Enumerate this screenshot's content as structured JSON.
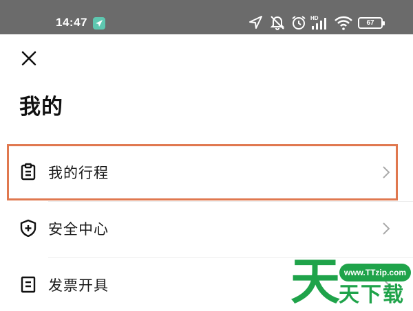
{
  "status_bar": {
    "time": "14:47",
    "battery": "67",
    "hd_label": "HD",
    "background": "#6b6b6b"
  },
  "header": {
    "close_icon": "close-icon",
    "title": "我的"
  },
  "menu": {
    "items": [
      {
        "label": "我的行程",
        "icon": "clipboard-icon",
        "highlighted": true
      },
      {
        "label": "安全中心",
        "icon": "shield-plus-icon"
      },
      {
        "label": "发票开具",
        "icon": "receipt-icon"
      }
    ]
  },
  "highlight_color": "#e0784f",
  "watermark": {
    "url": "www.TTzip.com",
    "big_char": "天",
    "sub_text": "天下载",
    "color": "#1fa34a"
  }
}
